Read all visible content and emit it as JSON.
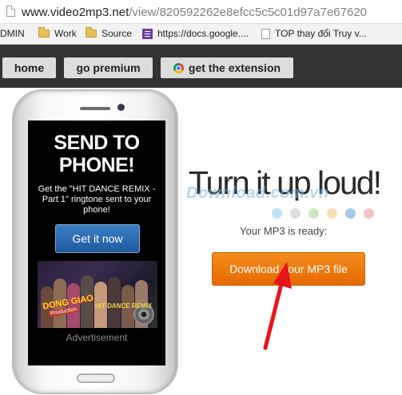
{
  "browser": {
    "url_host": "www.video2mp3.net",
    "url_path": "/view/820592262e8efcc5c5c01d97a7e67620"
  },
  "bookmarks": [
    {
      "label": "DMIN",
      "icon": "none"
    },
    {
      "label": "Work",
      "icon": "folder-icon"
    },
    {
      "label": "Source",
      "icon": "folder-icon"
    },
    {
      "label": "https://docs.google....",
      "icon": "google-docs-icon"
    },
    {
      "label": "TOP thay đổi Truy v...",
      "icon": "page-icon"
    }
  ],
  "nav": {
    "home": "home",
    "premium": "go premium",
    "extension": "get the extension"
  },
  "ad": {
    "heading": "SEND TO PHONE!",
    "text": "Get the \"HIT DANCE REMIX - Part 1\" ringtone sent to your phone!",
    "button": "Get it now",
    "image_logo": "DONG GIAO",
    "image_logo_sub": "Production",
    "image_caption": "HIT DANCE REMIX",
    "label": "Advertisement"
  },
  "main": {
    "headline": "Turn it up loud!",
    "watermark": "Download.com.vn",
    "status": "Your MP3 is ready:",
    "download_button": "Download your MP3 file"
  },
  "colors": {
    "nav_bg": "#333333",
    "download_button": "#f07d10",
    "ad_button": "#2f6db5",
    "arrow": "#e8141b",
    "dots": [
      "#bde1f4",
      "#dedede",
      "#cbe8c4",
      "#f7e0b6",
      "#a6c8ea",
      "#f5c4c4"
    ]
  }
}
